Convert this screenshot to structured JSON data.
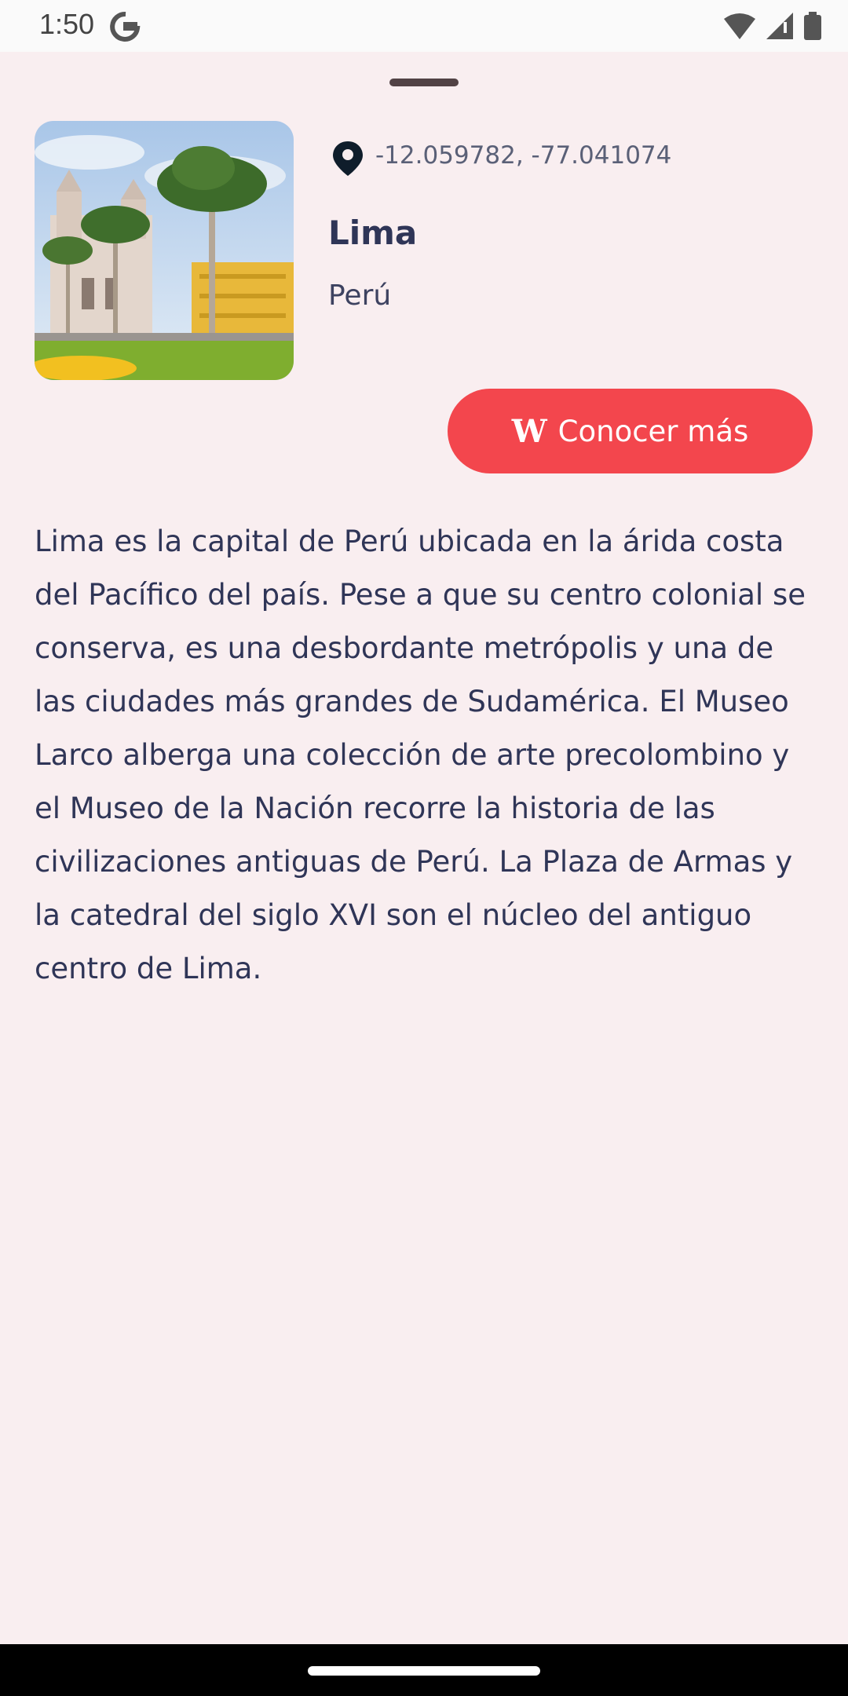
{
  "status": {
    "time": "1:50"
  },
  "place": {
    "coordinates": "-12.059782, -77.041074",
    "name": "Lima",
    "country": "Perú",
    "image_alt": "Plaza de Armas de Lima"
  },
  "button": {
    "label": "Conocer más",
    "icon": "wikipedia-w-icon",
    "color": "#f3464d"
  },
  "description": "Lima es la capital de Perú ubicada en la árida costa del Pacífico del país. Pese a que su centro colonial se conserva, es una desbordante metrópolis y una de las ciudades más grandes de Sudamérica. El Museo Larco alberga una colección de arte precolombino y el Museo de la Nación recorre la historia de las civilizaciones antiguas de Perú. La Plaza de Armas y la catedral del siglo XVI son el núcleo del antiguo centro de Lima."
}
